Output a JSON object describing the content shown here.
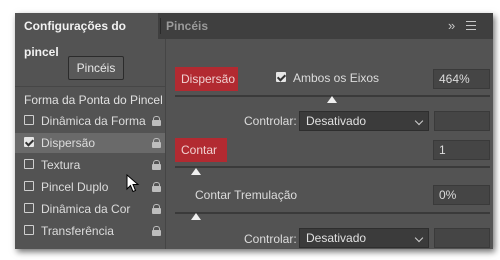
{
  "tabs": {
    "active": "Configurações do pincel",
    "inactive": "Pincéis",
    "collapse_icon": "double-chevron-right-icon",
    "menu_icon": "hamburger-menu-icon"
  },
  "left": {
    "brushes_button": "Pincéis",
    "tip_title": "Forma da Ponta do Pincel",
    "items": [
      {
        "label": "Dinâmica da Forma",
        "checked": false
      },
      {
        "label": "Dispersão",
        "checked": true
      },
      {
        "label": "Textura",
        "checked": false
      },
      {
        "label": "Pincel Duplo",
        "checked": false
      },
      {
        "label": "Dinâmica da Cor",
        "checked": false
      },
      {
        "label": "Transferência",
        "checked": false
      }
    ]
  },
  "right": {
    "scatter_label": "Dispersão",
    "both_axes_label": "Ambos os Eixos",
    "both_axes_checked": true,
    "scatter_value": "464%",
    "control_label_1": "Controlar:",
    "control_value_1": "Desativado",
    "count_label": "Contar",
    "count_value": "1",
    "count_jitter_label": "Contar Tremulação",
    "count_jitter_value": "0%",
    "control_label_2": "Controlar:",
    "control_value_2": "Desativado"
  },
  "colors": {
    "highlight_red": "#b22a31",
    "panel_bg": "#535353",
    "tab_bar_bg": "#3f3f3f"
  }
}
